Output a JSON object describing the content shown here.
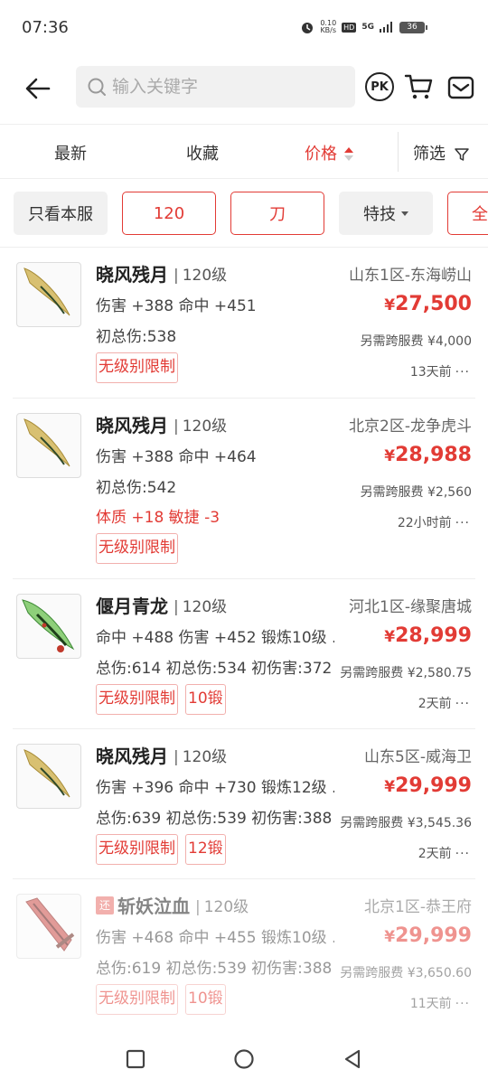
{
  "status_bar": {
    "time": "07:36",
    "net_speed_value": "0.10",
    "net_speed_unit": "KB/s",
    "hd": "HD",
    "signal": "5G",
    "battery": "36"
  },
  "search": {
    "placeholder": "输入关键字",
    "icons": [
      "back-arrow-icon",
      "search-icon",
      "pk-icon",
      "cart-icon",
      "mail-icon"
    ]
  },
  "sort": {
    "newest": "最新",
    "favorites": "收藏",
    "price": "价格",
    "filter": "筛选"
  },
  "filters": {
    "server_only": "只看本服",
    "level": "120",
    "weapon": "刀",
    "special": "特技",
    "all": "全"
  },
  "items": [
    {
      "name": "晓风残月",
      "level": "120级",
      "lines": [
        "伤害 +388 命中 +451",
        "初总伤:538"
      ],
      "red_line": "",
      "tags": [
        "无级别限制"
      ],
      "server": "山东1区-东海崂山",
      "price": "27,500",
      "fee": "另需跨服费 ¥4,000",
      "time": "13天前"
    },
    {
      "name": "晓风残月",
      "level": "120级",
      "lines": [
        "伤害 +388 命中 +464",
        "初总伤:542"
      ],
      "red_line": "体质 +18 敏捷 -3",
      "tags": [
        "无级别限制"
      ],
      "server": "北京2区-龙争虎斗",
      "price": "28,988",
      "fee": "另需跨服费 ¥2,560",
      "time": "22小时前"
    },
    {
      "name": "偃月青龙",
      "level": "120级",
      "lines": [
        "命中 +488 伤害 +452 锻炼10级 ...",
        "总伤:614 初总伤:534 初伤害:372"
      ],
      "red_line": "",
      "tags": [
        "无级别限制",
        "10锻"
      ],
      "server": "河北1区-缘聚唐城",
      "price": "28,999",
      "fee": "另需跨服费 ¥2,580.75",
      "time": "2天前"
    },
    {
      "name": "晓风残月",
      "level": "120级",
      "lines": [
        "伤害 +396 命中 +730 锻炼12级 ...",
        "总伤:639 初总伤:539 初伤害:388"
      ],
      "red_line": "",
      "tags": [
        "无级别限制",
        "12锻"
      ],
      "server": "山东5区-威海卫",
      "price": "29,999",
      "fee": "另需跨服费 ¥3,545.36",
      "time": "2天前"
    },
    {
      "name": "斩妖泣血",
      "level": "120级",
      "badge": "还",
      "lines": [
        "伤害 +468 命中 +455 锻炼10级 ...",
        "总伤:619 初总伤:539 初伤害:388"
      ],
      "red_line": "",
      "tags": [
        "无级别限制",
        "10锻"
      ],
      "server": "北京1区-恭王府",
      "price": "29,999",
      "fee": "另需跨服费 ¥3,650.60",
      "time": "11天前"
    }
  ],
  "currency_symbol": "¥",
  "more_symbol": "···",
  "colors": {
    "accent": "#e23b35",
    "text": "#222222",
    "muted": "#666666",
    "tag_border": "#f2b0ad"
  }
}
